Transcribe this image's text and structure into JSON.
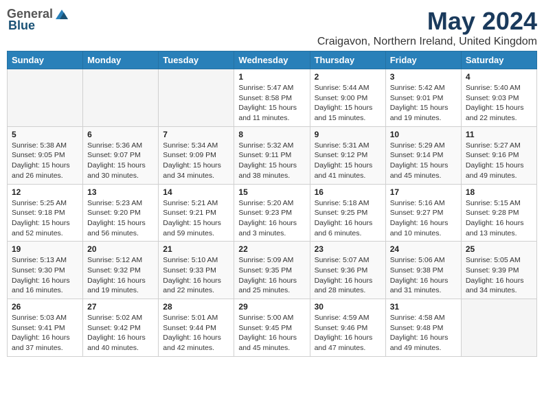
{
  "header": {
    "logo_general": "General",
    "logo_blue": "Blue",
    "month_year": "May 2024",
    "location": "Craigavon, Northern Ireland, United Kingdom"
  },
  "days_of_week": [
    "Sunday",
    "Monday",
    "Tuesday",
    "Wednesday",
    "Thursday",
    "Friday",
    "Saturday"
  ],
  "weeks": [
    [
      {
        "day": "",
        "content": ""
      },
      {
        "day": "",
        "content": ""
      },
      {
        "day": "",
        "content": ""
      },
      {
        "day": "1",
        "content": "Sunrise: 5:47 AM\nSunset: 8:58 PM\nDaylight: 15 hours\nand 11 minutes."
      },
      {
        "day": "2",
        "content": "Sunrise: 5:44 AM\nSunset: 9:00 PM\nDaylight: 15 hours\nand 15 minutes."
      },
      {
        "day": "3",
        "content": "Sunrise: 5:42 AM\nSunset: 9:01 PM\nDaylight: 15 hours\nand 19 minutes."
      },
      {
        "day": "4",
        "content": "Sunrise: 5:40 AM\nSunset: 9:03 PM\nDaylight: 15 hours\nand 22 minutes."
      }
    ],
    [
      {
        "day": "5",
        "content": "Sunrise: 5:38 AM\nSunset: 9:05 PM\nDaylight: 15 hours\nand 26 minutes."
      },
      {
        "day": "6",
        "content": "Sunrise: 5:36 AM\nSunset: 9:07 PM\nDaylight: 15 hours\nand 30 minutes."
      },
      {
        "day": "7",
        "content": "Sunrise: 5:34 AM\nSunset: 9:09 PM\nDaylight: 15 hours\nand 34 minutes."
      },
      {
        "day": "8",
        "content": "Sunrise: 5:32 AM\nSunset: 9:11 PM\nDaylight: 15 hours\nand 38 minutes."
      },
      {
        "day": "9",
        "content": "Sunrise: 5:31 AM\nSunset: 9:12 PM\nDaylight: 15 hours\nand 41 minutes."
      },
      {
        "day": "10",
        "content": "Sunrise: 5:29 AM\nSunset: 9:14 PM\nDaylight: 15 hours\nand 45 minutes."
      },
      {
        "day": "11",
        "content": "Sunrise: 5:27 AM\nSunset: 9:16 PM\nDaylight: 15 hours\nand 49 minutes."
      }
    ],
    [
      {
        "day": "12",
        "content": "Sunrise: 5:25 AM\nSunset: 9:18 PM\nDaylight: 15 hours\nand 52 minutes."
      },
      {
        "day": "13",
        "content": "Sunrise: 5:23 AM\nSunset: 9:20 PM\nDaylight: 15 hours\nand 56 minutes."
      },
      {
        "day": "14",
        "content": "Sunrise: 5:21 AM\nSunset: 9:21 PM\nDaylight: 15 hours\nand 59 minutes."
      },
      {
        "day": "15",
        "content": "Sunrise: 5:20 AM\nSunset: 9:23 PM\nDaylight: 16 hours\nand 3 minutes."
      },
      {
        "day": "16",
        "content": "Sunrise: 5:18 AM\nSunset: 9:25 PM\nDaylight: 16 hours\nand 6 minutes."
      },
      {
        "day": "17",
        "content": "Sunrise: 5:16 AM\nSunset: 9:27 PM\nDaylight: 16 hours\nand 10 minutes."
      },
      {
        "day": "18",
        "content": "Sunrise: 5:15 AM\nSunset: 9:28 PM\nDaylight: 16 hours\nand 13 minutes."
      }
    ],
    [
      {
        "day": "19",
        "content": "Sunrise: 5:13 AM\nSunset: 9:30 PM\nDaylight: 16 hours\nand 16 minutes."
      },
      {
        "day": "20",
        "content": "Sunrise: 5:12 AM\nSunset: 9:32 PM\nDaylight: 16 hours\nand 19 minutes."
      },
      {
        "day": "21",
        "content": "Sunrise: 5:10 AM\nSunset: 9:33 PM\nDaylight: 16 hours\nand 22 minutes."
      },
      {
        "day": "22",
        "content": "Sunrise: 5:09 AM\nSunset: 9:35 PM\nDaylight: 16 hours\nand 25 minutes."
      },
      {
        "day": "23",
        "content": "Sunrise: 5:07 AM\nSunset: 9:36 PM\nDaylight: 16 hours\nand 28 minutes."
      },
      {
        "day": "24",
        "content": "Sunrise: 5:06 AM\nSunset: 9:38 PM\nDaylight: 16 hours\nand 31 minutes."
      },
      {
        "day": "25",
        "content": "Sunrise: 5:05 AM\nSunset: 9:39 PM\nDaylight: 16 hours\nand 34 minutes."
      }
    ],
    [
      {
        "day": "26",
        "content": "Sunrise: 5:03 AM\nSunset: 9:41 PM\nDaylight: 16 hours\nand 37 minutes."
      },
      {
        "day": "27",
        "content": "Sunrise: 5:02 AM\nSunset: 9:42 PM\nDaylight: 16 hours\nand 40 minutes."
      },
      {
        "day": "28",
        "content": "Sunrise: 5:01 AM\nSunset: 9:44 PM\nDaylight: 16 hours\nand 42 minutes."
      },
      {
        "day": "29",
        "content": "Sunrise: 5:00 AM\nSunset: 9:45 PM\nDaylight: 16 hours\nand 45 minutes."
      },
      {
        "day": "30",
        "content": "Sunrise: 4:59 AM\nSunset: 9:46 PM\nDaylight: 16 hours\nand 47 minutes."
      },
      {
        "day": "31",
        "content": "Sunrise: 4:58 AM\nSunset: 9:48 PM\nDaylight: 16 hours\nand 49 minutes."
      },
      {
        "day": "",
        "content": ""
      }
    ]
  ]
}
